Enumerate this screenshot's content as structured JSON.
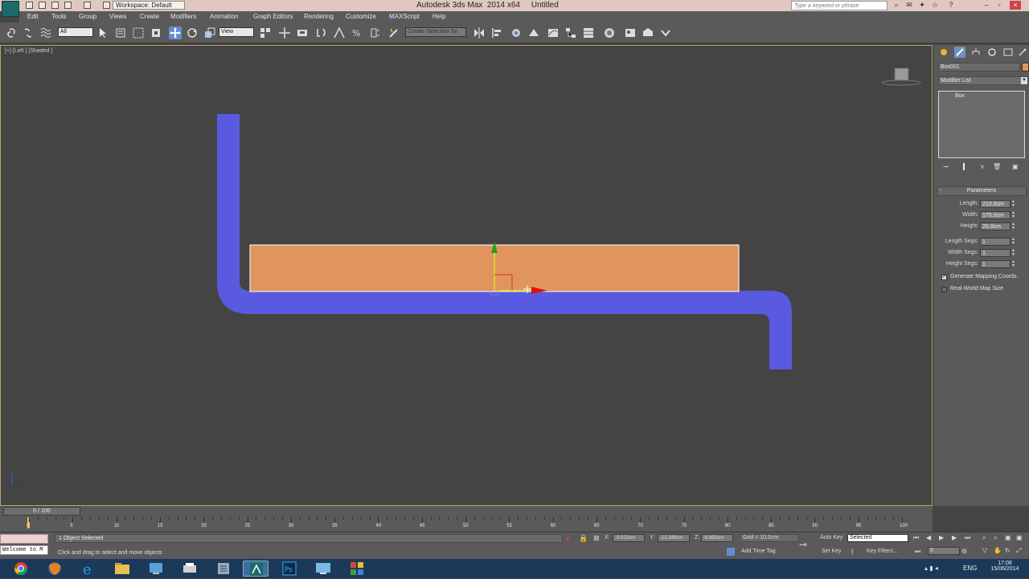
{
  "titlebar": {
    "workspace": "Workspace: Default",
    "app_title": "Autodesk 3ds Max  2014 x64",
    "doc_title": "Untitled",
    "search_placeholder": "Type a keyword or phrase"
  },
  "menu": [
    "Edit",
    "Tools",
    "Group",
    "Views",
    "Create",
    "Modifiers",
    "Animation",
    "Graph Editors",
    "Rendering",
    "Customize",
    "MAXScript",
    "Help"
  ],
  "toolbar": {
    "selection_filter": "All",
    "ref_coord": "View",
    "named_selection": "Create Selection Se"
  },
  "viewport": {
    "label": "[+] [Left ] [Shaded ]",
    "box_color": "#e0955e",
    "tube_color": "#5a5ae0"
  },
  "command_panel": {
    "object_name": "Box001",
    "object_color": "#e0955e",
    "modifier_list": "Modifier List",
    "stack_item": "Box",
    "parameters_title": "Parameters",
    "params": [
      {
        "label": "Length:",
        "value": "210.0cm"
      },
      {
        "label": "Width:",
        "value": "170.0cm"
      },
      {
        "label": "Height:",
        "value": "20.0cm"
      },
      {
        "label": "Length Segs:",
        "value": "1"
      },
      {
        "label": "Width Segs:",
        "value": "1"
      },
      {
        "label": "Height Segs:",
        "value": "1"
      }
    ],
    "generate_mapping": "Generate Mapping Coords.",
    "real_world": "Real-World Map Size"
  },
  "timeline": {
    "slider_label": "0 / 100",
    "ticks": [
      "0",
      "5",
      "10",
      "15",
      "20",
      "25",
      "30",
      "35",
      "40",
      "45",
      "50",
      "55",
      "60",
      "65",
      "70",
      "75",
      "80",
      "85",
      "90",
      "95",
      "100"
    ]
  },
  "status": {
    "listener": "Welcome to M",
    "selected": "1 Object Selected",
    "prompt": "Click and drag to select and move objects",
    "x_label": "X:",
    "x_value": "-0.022cm",
    "y_label": "Y:",
    "y_value": "-12.348cm",
    "z_label": "Z:",
    "z_value": "-6.892cm",
    "grid": "Grid = 10.0cm",
    "add_time_tag": "Add Time Tag",
    "auto_key": "Auto Key",
    "set_key": "Set Key",
    "key_mode": "Selected",
    "key_filters": "Key Filters...",
    "frame": "0"
  },
  "taskbar": {
    "lang": "ENG",
    "time": "17:08",
    "date": "15/06/2014"
  }
}
